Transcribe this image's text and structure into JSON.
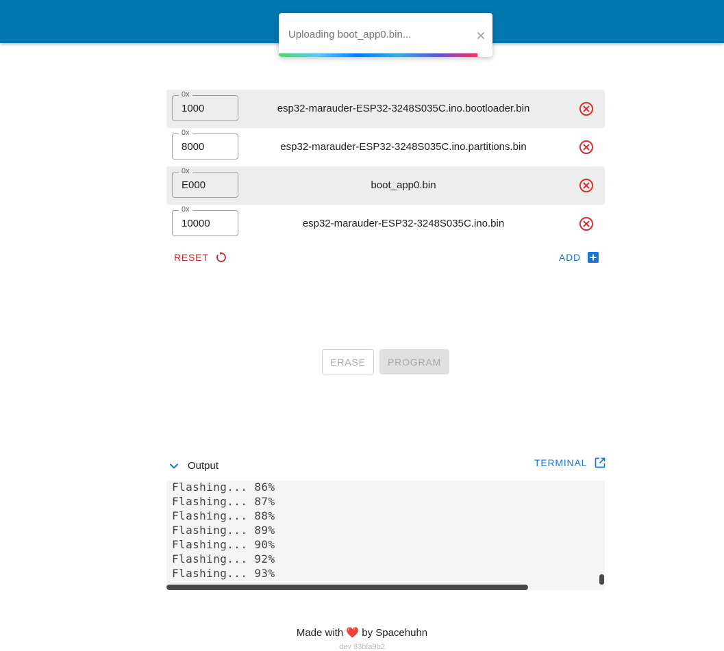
{
  "toast": {
    "message": "Uploading boot_app0.bin...",
    "close_icon": "close-icon"
  },
  "partitions": [
    {
      "offset_label": "0x",
      "offset": "1000",
      "file": "esp32-marauder-ESP32-3248S035C.ino.bootloader.bin"
    },
    {
      "offset_label": "0x",
      "offset": "8000",
      "file": "esp32-marauder-ESP32-3248S035C.ino.partitions.bin"
    },
    {
      "offset_label": "0x",
      "offset": "E000",
      "file": "boot_app0.bin"
    },
    {
      "offset_label": "0x",
      "offset": "10000",
      "file": "esp32-marauder-ESP32-3248S035C.ino.bin"
    }
  ],
  "actions": {
    "reset": "RESET",
    "add": "ADD",
    "erase": "ERASE",
    "program": "PROGRAM"
  },
  "output": {
    "title": "Output",
    "terminal": "TERMINAL",
    "lines": [
      "Flashing... 86%",
      "Flashing... 87%",
      "Flashing... 88%",
      "Flashing... 89%",
      "Flashing... 90%",
      "Flashing... 92%",
      "Flashing... 93%"
    ]
  },
  "footer": {
    "prefix": "Made with",
    "heart": "❤️",
    "suffix": "by Spacehuhn",
    "version": "dev 83bfa9b2"
  },
  "colors": {
    "appbar": "#0277b0",
    "danger": "#c62828",
    "accent": "#1976d2"
  }
}
